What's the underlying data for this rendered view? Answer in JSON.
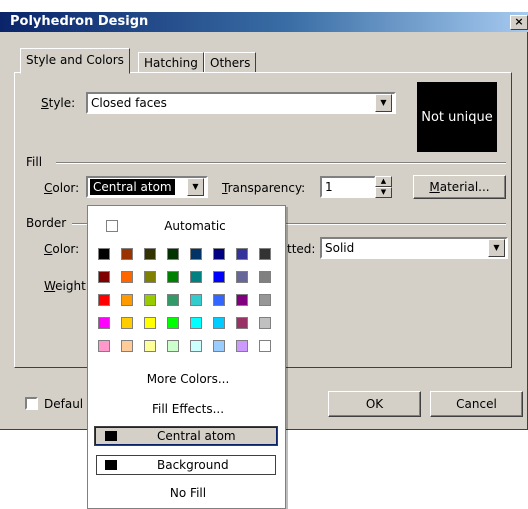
{
  "window": {
    "title": "Polyhedron Design",
    "close_glyph": "×"
  },
  "tabs": [
    {
      "label": "Style and Colors",
      "active": true
    },
    {
      "label": "Hatching",
      "active": false
    },
    {
      "label": "Others",
      "active": false
    }
  ],
  "style": {
    "label_u": "S",
    "label_rest": "tyle:",
    "value": "Closed faces"
  },
  "preview": {
    "text": "Not unique"
  },
  "fill": {
    "group_label": "Fill",
    "color_label_u": "C",
    "color_label_rest": "olor:",
    "color_value": "Central atom",
    "transparency_label_u": "T",
    "transparency_label_rest": "ransparency:",
    "transparency_value": "1",
    "material_u": "M",
    "material_rest": "aterial..."
  },
  "border": {
    "group_label": "Border",
    "color_label_u": "C",
    "color_label_rest": "olor:",
    "dotted_label": "tted:",
    "dotted_value": "Solid",
    "weight_label_u": "W",
    "weight_label_rest": "eight"
  },
  "footer": {
    "default_label": "Defaul",
    "ok_label": "OK",
    "cancel_label": "Cancel"
  },
  "color_popup": {
    "automatic_label": "Automatic",
    "more_colors_label": "More Colors...",
    "fill_effects_label": "Fill Effects...",
    "central_atom_label": "Central atom",
    "background_label": "Background",
    "no_fill_label": "No Fill",
    "palette": [
      [
        "#000000",
        "#993300",
        "#333300",
        "#003300",
        "#003366",
        "#000080",
        "#333399",
        "#333333"
      ],
      [
        "#800000",
        "#ff6600",
        "#808000",
        "#008000",
        "#008080",
        "#0000ff",
        "#666699",
        "#808080"
      ],
      [
        "#ff0000",
        "#ff9900",
        "#99cc00",
        "#339966",
        "#33cccc",
        "#3366ff",
        "#800080",
        "#969696"
      ],
      [
        "#ff00ff",
        "#ffcc00",
        "#ffff00",
        "#00ff00",
        "#00ffff",
        "#00ccff",
        "#993366",
        "#c0c0c0"
      ],
      [
        "#ff99cc",
        "#ffcc99",
        "#ffff99",
        "#ccffcc",
        "#ccffff",
        "#99ccff",
        "#cc99ff",
        "#ffffff"
      ]
    ]
  }
}
